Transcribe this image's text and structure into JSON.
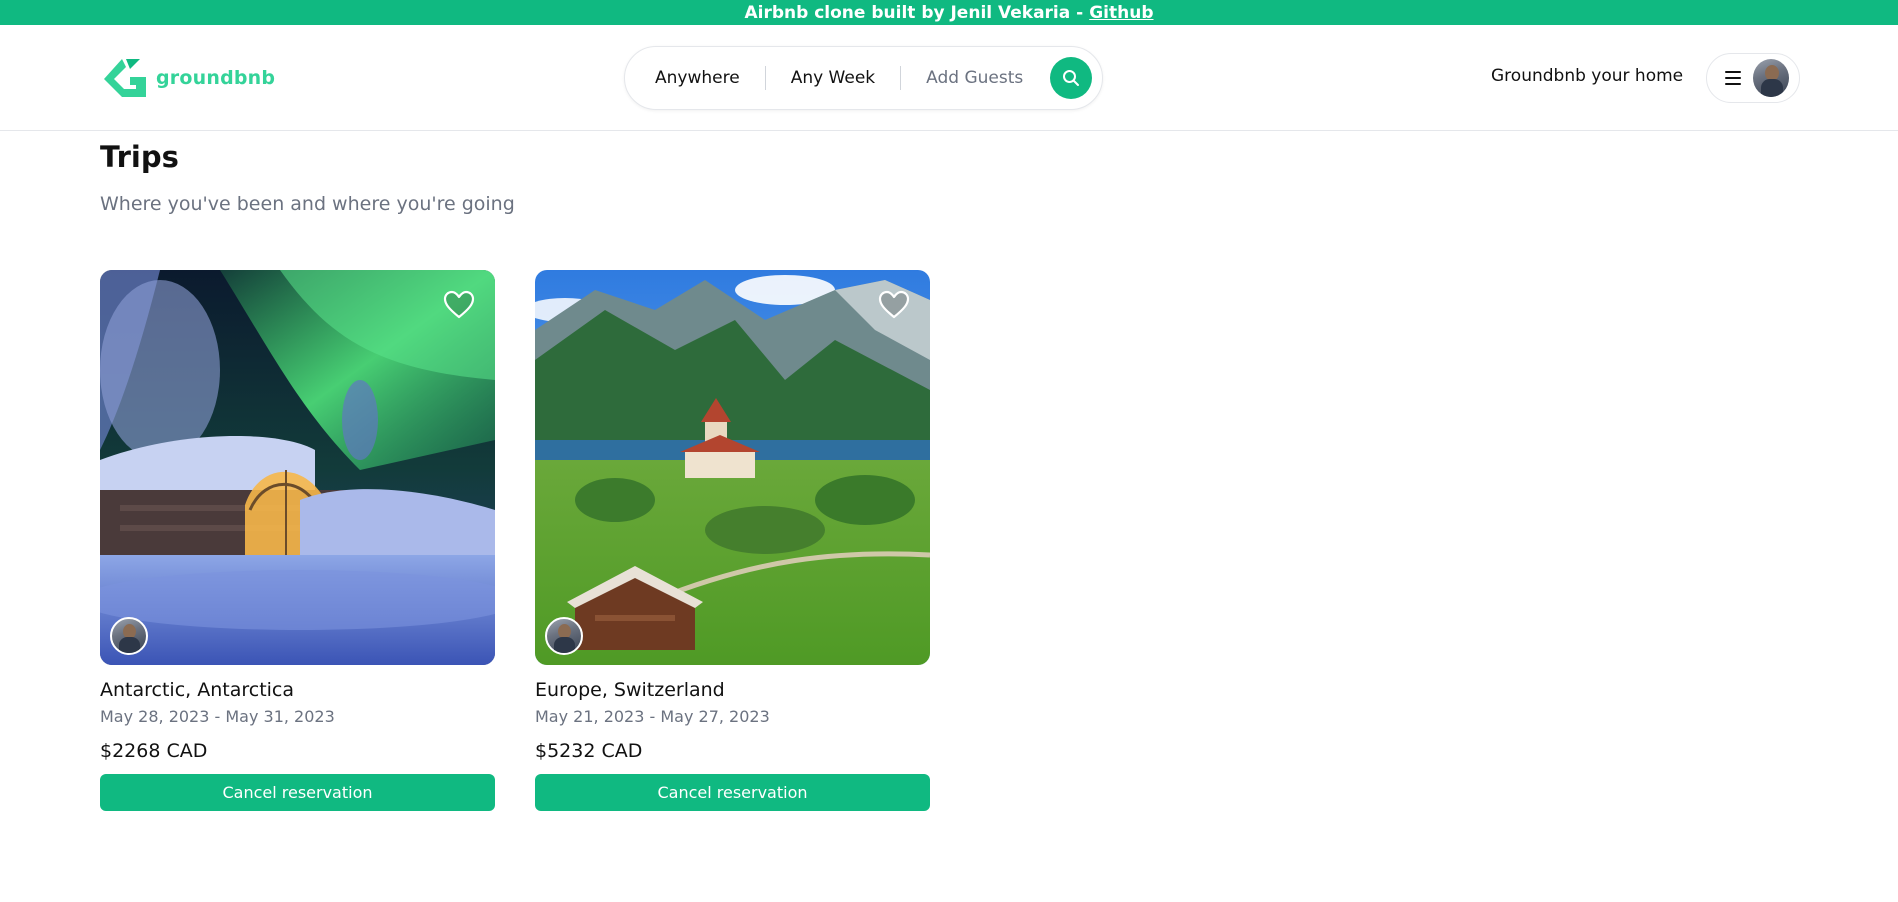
{
  "banner": {
    "text": "Airbnb clone built by Jenil Vekaria -",
    "link_label": "Github"
  },
  "header": {
    "logo_text": "groundbnb",
    "search": {
      "where": "Anywhere",
      "when": "Any Week",
      "guests": "Add Guests"
    },
    "host_link": "Groundbnb your home"
  },
  "page": {
    "title": "Trips",
    "subtitle": "Where you've been and where you're going"
  },
  "trips": [
    {
      "location": "Antarctic, Antarctica",
      "dates": "May 28, 2023 - May 31, 2023",
      "price": "$2268 CAD",
      "cancel_label": "Cancel reservation"
    },
    {
      "location": "Europe, Switzerland",
      "dates": "May 21, 2023 - May 27, 2023",
      "price": "$5232 CAD",
      "cancel_label": "Cancel reservation"
    }
  ],
  "colors": {
    "brand": "#10b981",
    "logo": "#34d399"
  },
  "icons": {
    "logo": "groundbnb-logo-icon",
    "search": "search-icon",
    "menu": "hamburger-menu-icon",
    "favorite": "heart-icon"
  }
}
